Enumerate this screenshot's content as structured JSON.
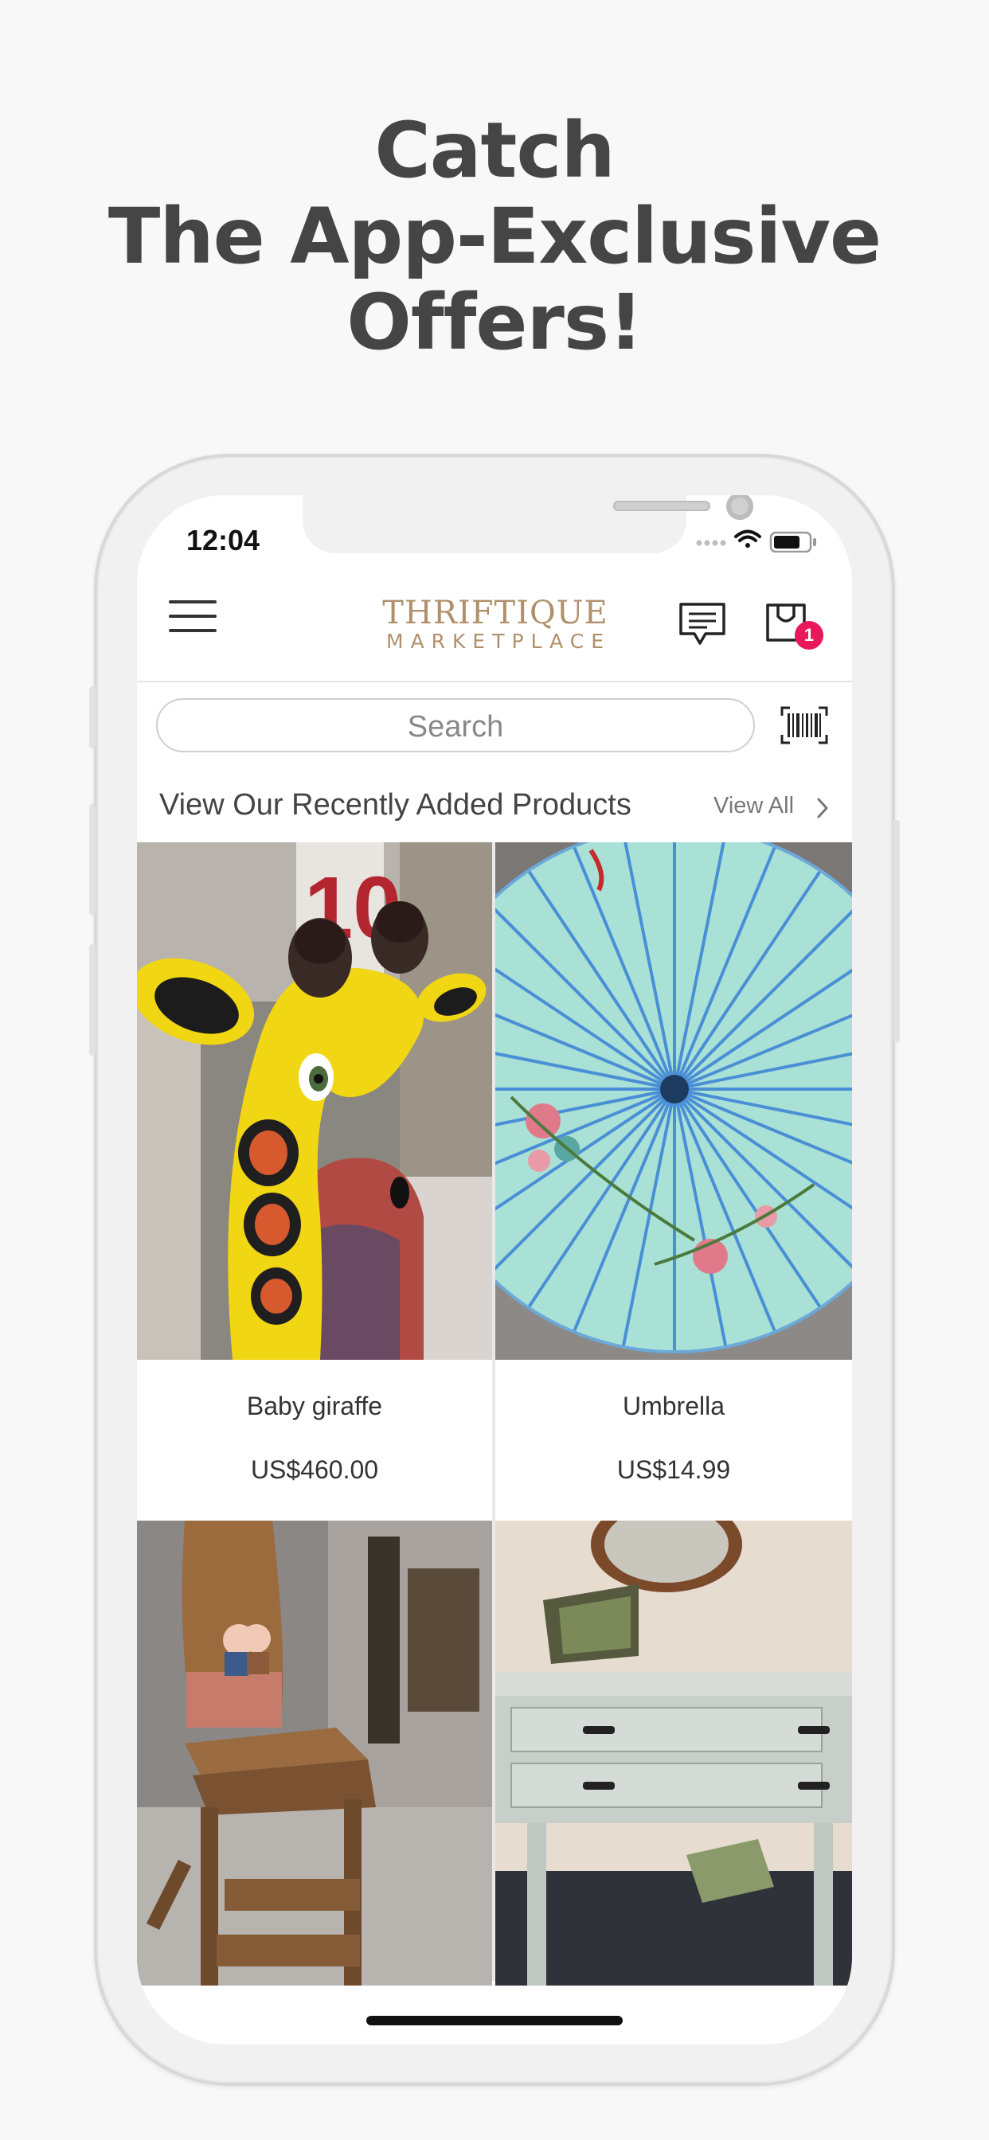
{
  "headline": {
    "line1": "Catch",
    "line2": "The App-Exclusive",
    "line3": "Offers!"
  },
  "status_bar": {
    "time": "12:04",
    "icons": [
      "signal-dots-icon",
      "wifi-icon",
      "battery-icon"
    ]
  },
  "app_bar": {
    "logo_line1": "THRIFTIQUE",
    "logo_line2": "MARKETPLACE",
    "cart_badge_count": "1",
    "icons": [
      "menu-icon",
      "chat-icon",
      "shopping-bag-icon"
    ]
  },
  "search": {
    "placeholder": "Search",
    "icons": [
      "barcode-scanner-icon"
    ]
  },
  "section": {
    "title": "View Our Recently Added Products",
    "view_all": "View All"
  },
  "products": [
    {
      "name": "Baby giraffe",
      "price": "US$460.00"
    },
    {
      "name": "Umbrella",
      "price": "US$14.99"
    },
    {
      "name": "",
      "price": ""
    },
    {
      "name": "",
      "price": ""
    }
  ],
  "colors": {
    "headline": "#454545",
    "logo": "#b0906a",
    "badge": "#e8185a",
    "background": "#f8f8f8"
  }
}
